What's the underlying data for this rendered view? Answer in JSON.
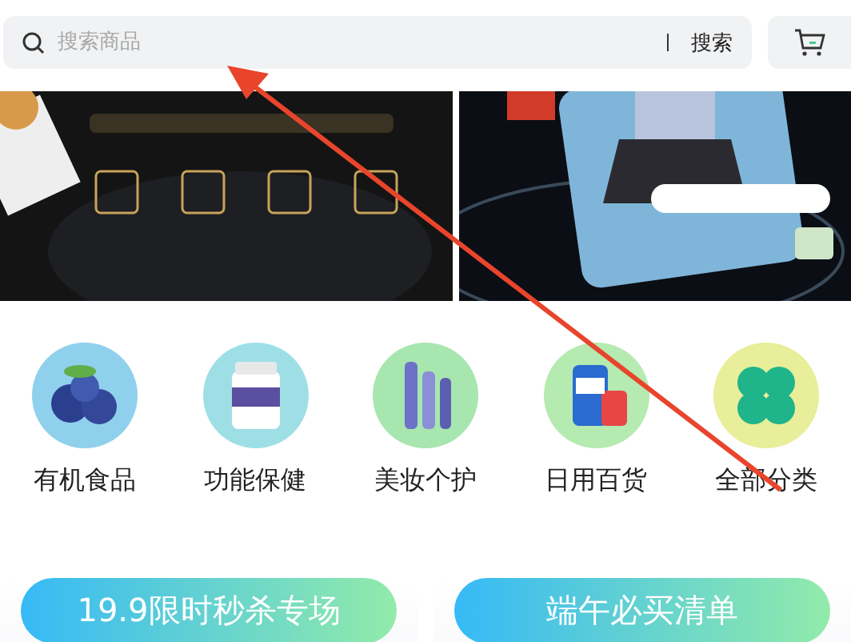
{
  "search": {
    "placeholder": "搜索商品",
    "button": "搜索"
  },
  "categories": [
    {
      "label": "有机食品",
      "color": "#8fd0ec"
    },
    {
      "label": "功能保健",
      "color": "#9edfe6"
    },
    {
      "label": "美妆个护",
      "color": "#a8e6b0"
    },
    {
      "label": "日用百货",
      "color": "#b5eab0"
    },
    {
      "label": "全部分类",
      "color": "#e8ee9a"
    }
  ],
  "promos": [
    {
      "title": "19.9限时秒杀专场"
    },
    {
      "title": "端午必买清单"
    }
  ]
}
